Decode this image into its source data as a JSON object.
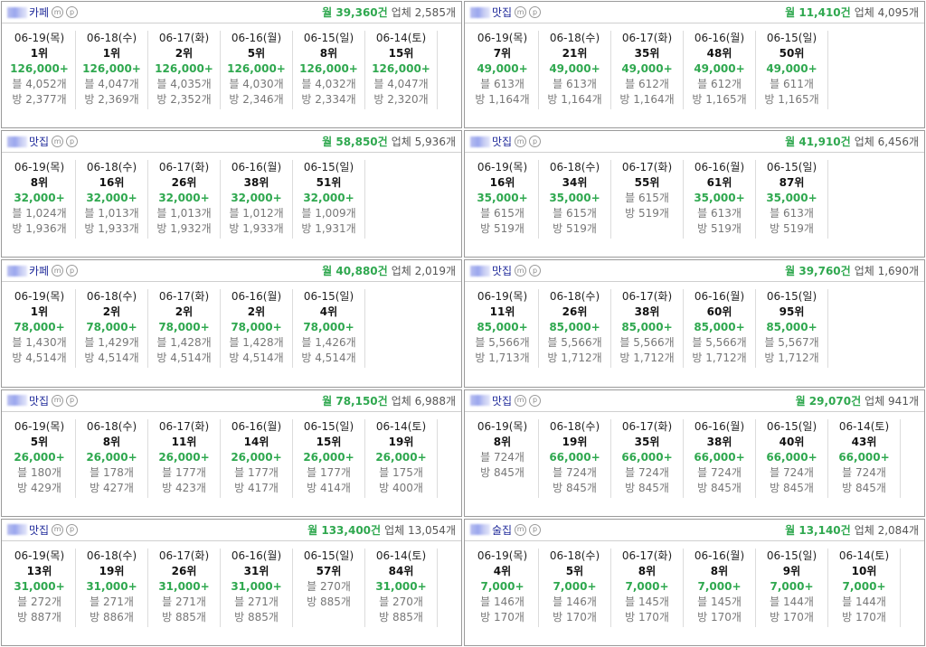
{
  "labels": {
    "monthly_prefix": "월",
    "monthly_suffix": "건",
    "biz_prefix": "업체",
    "biz_suffix": "개",
    "badge_m": "m",
    "badge_p": "p"
  },
  "colors": {
    "accent_green": "#2fa84f",
    "category_blue": "#1f2a9a",
    "border": "#9a9a9a"
  },
  "cards": [
    {
      "category": "카페",
      "monthly": "월 39,360건",
      "biz": "업체 2,585개",
      "columns": [
        {
          "date": "06-19(목)",
          "rank": "1위",
          "price": "126,000+",
          "blog": "블 4,052개",
          "bang": "방 2,377개"
        },
        {
          "date": "06-18(수)",
          "rank": "1위",
          "price": "126,000+",
          "blog": "블 4,047개",
          "bang": "방 2,369개"
        },
        {
          "date": "06-17(화)",
          "rank": "2위",
          "price": "126,000+",
          "blog": "블 4,035개",
          "bang": "방 2,352개"
        },
        {
          "date": "06-16(월)",
          "rank": "5위",
          "price": "126,000+",
          "blog": "블 4,030개",
          "bang": "방 2,346개"
        },
        {
          "date": "06-15(일)",
          "rank": "8위",
          "price": "126,000+",
          "blog": "블 4,032개",
          "bang": "방 2,334개"
        },
        {
          "date": "06-14(토)",
          "rank": "15위",
          "price": "126,000+",
          "blog": "블 4,047개",
          "bang": "방 2,320개"
        }
      ]
    },
    {
      "category": "맛집",
      "monthly": "월 11,410건",
      "biz": "업체 4,095개",
      "columns": [
        {
          "date": "06-19(목)",
          "rank": "7위",
          "price": "49,000+",
          "blog": "블 613개",
          "bang": "방 1,164개"
        },
        {
          "date": "06-18(수)",
          "rank": "21위",
          "price": "49,000+",
          "blog": "블 613개",
          "bang": "방 1,164개"
        },
        {
          "date": "06-17(화)",
          "rank": "35위",
          "price": "49,000+",
          "blog": "블 612개",
          "bang": "방 1,164개"
        },
        {
          "date": "06-16(월)",
          "rank": "48위",
          "price": "49,000+",
          "blog": "블 612개",
          "bang": "방 1,165개"
        },
        {
          "date": "06-15(일)",
          "rank": "50위",
          "price": "49,000+",
          "blog": "블 611개",
          "bang": "방 1,165개"
        }
      ]
    },
    {
      "category": "맛집",
      "monthly": "월 58,850건",
      "biz": "업체 5,936개",
      "columns": [
        {
          "date": "06-19(목)",
          "rank": "8위",
          "price": "32,000+",
          "blog": "블 1,024개",
          "bang": "방 1,936개"
        },
        {
          "date": "06-18(수)",
          "rank": "16위",
          "price": "32,000+",
          "blog": "블 1,013개",
          "bang": "방 1,933개"
        },
        {
          "date": "06-17(화)",
          "rank": "26위",
          "price": "32,000+",
          "blog": "블 1,013개",
          "bang": "방 1,932개"
        },
        {
          "date": "06-16(월)",
          "rank": "38위",
          "price": "32,000+",
          "blog": "블 1,012개",
          "bang": "방 1,933개"
        },
        {
          "date": "06-15(일)",
          "rank": "51위",
          "price": "32,000+",
          "blog": "블 1,009개",
          "bang": "방 1,931개"
        }
      ]
    },
    {
      "category": "맛집",
      "monthly": "월 41,910건",
      "biz": "업체 6,456개",
      "columns": [
        {
          "date": "06-19(목)",
          "rank": "16위",
          "price": "35,000+",
          "blog": "블 615개",
          "bang": "방 519개"
        },
        {
          "date": "06-18(수)",
          "rank": "34위",
          "price": "35,000+",
          "blog": "블 615개",
          "bang": "방 519개"
        },
        {
          "date": "06-17(화)",
          "rank": "55위",
          "price": "",
          "blog": "블 615개",
          "bang": "방 519개"
        },
        {
          "date": "06-16(월)",
          "rank": "61위",
          "price": "35,000+",
          "blog": "블 613개",
          "bang": "방 519개"
        },
        {
          "date": "06-15(일)",
          "rank": "87위",
          "price": "35,000+",
          "blog": "블 613개",
          "bang": "방 519개"
        }
      ]
    },
    {
      "category": "카페",
      "monthly": "월 40,880건",
      "biz": "업체 2,019개",
      "columns": [
        {
          "date": "06-19(목)",
          "rank": "1위",
          "price": "78,000+",
          "blog": "블 1,430개",
          "bang": "방 4,514개"
        },
        {
          "date": "06-18(수)",
          "rank": "2위",
          "price": "78,000+",
          "blog": "블 1,429개",
          "bang": "방 4,514개"
        },
        {
          "date": "06-17(화)",
          "rank": "2위",
          "price": "78,000+",
          "blog": "블 1,428개",
          "bang": "방 4,514개"
        },
        {
          "date": "06-16(월)",
          "rank": "2위",
          "price": "78,000+",
          "blog": "블 1,428개",
          "bang": "방 4,514개"
        },
        {
          "date": "06-15(일)",
          "rank": "4위",
          "price": "78,000+",
          "blog": "블 1,426개",
          "bang": "방 4,514개"
        }
      ]
    },
    {
      "category": "맛집",
      "monthly": "월 39,760건",
      "biz": "업체 1,690개",
      "columns": [
        {
          "date": "06-19(목)",
          "rank": "11위",
          "price": "85,000+",
          "blog": "블 5,566개",
          "bang": "방 1,713개"
        },
        {
          "date": "06-18(수)",
          "rank": "26위",
          "price": "85,000+",
          "blog": "블 5,566개",
          "bang": "방 1,712개"
        },
        {
          "date": "06-17(화)",
          "rank": "38위",
          "price": "85,000+",
          "blog": "블 5,566개",
          "bang": "방 1,712개"
        },
        {
          "date": "06-16(월)",
          "rank": "60위",
          "price": "85,000+",
          "blog": "블 5,566개",
          "bang": "방 1,712개"
        },
        {
          "date": "06-15(일)",
          "rank": "95위",
          "price": "85,000+",
          "blog": "블 5,567개",
          "bang": "방 1,712개"
        }
      ]
    },
    {
      "category": "맛집",
      "monthly": "월 78,150건",
      "biz": "업체 6,988개",
      "columns": [
        {
          "date": "06-19(목)",
          "rank": "5위",
          "price": "26,000+",
          "blog": "블 180개",
          "bang": "방 429개"
        },
        {
          "date": "06-18(수)",
          "rank": "8위",
          "price": "26,000+",
          "blog": "블 178개",
          "bang": "방 427개"
        },
        {
          "date": "06-17(화)",
          "rank": "11위",
          "price": "26,000+",
          "blog": "블 177개",
          "bang": "방 423개"
        },
        {
          "date": "06-16(월)",
          "rank": "14위",
          "price": "26,000+",
          "blog": "블 177개",
          "bang": "방 417개"
        },
        {
          "date": "06-15(일)",
          "rank": "15위",
          "price": "26,000+",
          "blog": "블 177개",
          "bang": "방 414개"
        },
        {
          "date": "06-14(토)",
          "rank": "19위",
          "price": "26,000+",
          "blog": "블 175개",
          "bang": "방 400개"
        }
      ]
    },
    {
      "category": "맛집",
      "monthly": "월 29,070건",
      "biz": "업체 941개",
      "columns": [
        {
          "date": "06-19(목)",
          "rank": "8위",
          "price": "",
          "blog": "블 724개",
          "bang": "방 845개"
        },
        {
          "date": "06-18(수)",
          "rank": "19위",
          "price": "66,000+",
          "blog": "블 724개",
          "bang": "방 845개"
        },
        {
          "date": "06-17(화)",
          "rank": "35위",
          "price": "66,000+",
          "blog": "블 724개",
          "bang": "방 845개"
        },
        {
          "date": "06-16(월)",
          "rank": "38위",
          "price": "66,000+",
          "blog": "블 724개",
          "bang": "방 845개"
        },
        {
          "date": "06-15(일)",
          "rank": "40위",
          "price": "66,000+",
          "blog": "블 724개",
          "bang": "방 845개"
        },
        {
          "date": "06-14(토)",
          "rank": "43위",
          "price": "66,000+",
          "blog": "블 724개",
          "bang": "방 845개"
        }
      ]
    },
    {
      "category": "맛집",
      "monthly": "월 133,400건",
      "biz": "업체 13,054개",
      "columns": [
        {
          "date": "06-19(목)",
          "rank": "13위",
          "price": "31,000+",
          "blog": "블 272개",
          "bang": "방 887개"
        },
        {
          "date": "06-18(수)",
          "rank": "19위",
          "price": "31,000+",
          "blog": "블 271개",
          "bang": "방 886개"
        },
        {
          "date": "06-17(화)",
          "rank": "26위",
          "price": "31,000+",
          "blog": "블 271개",
          "bang": "방 885개"
        },
        {
          "date": "06-16(월)",
          "rank": "31위",
          "price": "31,000+",
          "blog": "블 271개",
          "bang": "방 885개"
        },
        {
          "date": "06-15(일)",
          "rank": "57위",
          "price": "",
          "blog": "블 270개",
          "bang": "방 885개"
        },
        {
          "date": "06-14(토)",
          "rank": "84위",
          "price": "31,000+",
          "blog": "블 270개",
          "bang": "방 885개"
        }
      ]
    },
    {
      "category": "술집",
      "monthly": "월 13,140건",
      "biz": "업체 2,084개",
      "columns": [
        {
          "date": "06-19(목)",
          "rank": "4위",
          "price": "7,000+",
          "blog": "블 146개",
          "bang": "방 170개"
        },
        {
          "date": "06-18(수)",
          "rank": "5위",
          "price": "7,000+",
          "blog": "블 146개",
          "bang": "방 170개"
        },
        {
          "date": "06-17(화)",
          "rank": "8위",
          "price": "7,000+",
          "blog": "블 145개",
          "bang": "방 170개"
        },
        {
          "date": "06-16(월)",
          "rank": "8위",
          "price": "7,000+",
          "blog": "블 145개",
          "bang": "방 170개"
        },
        {
          "date": "06-15(일)",
          "rank": "9위",
          "price": "7,000+",
          "blog": "블 144개",
          "bang": "방 170개"
        },
        {
          "date": "06-14(토)",
          "rank": "10위",
          "price": "7,000+",
          "blog": "블 144개",
          "bang": "방 170개"
        }
      ]
    }
  ]
}
